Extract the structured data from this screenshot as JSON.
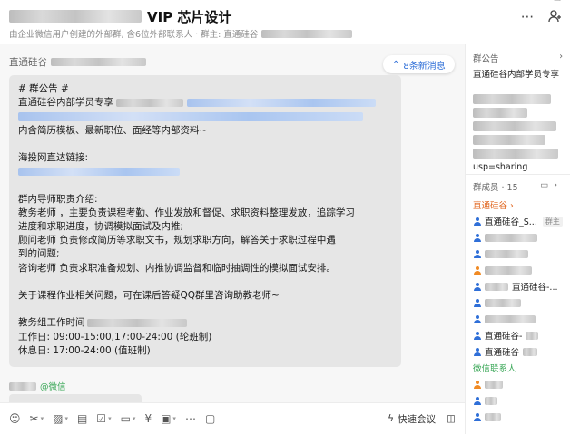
{
  "header": {
    "title": "VIP 芯片设计",
    "subtitle": "由企业微信用户创建的外部群, 含6位外部联系人 · 群主: 直通硅谷"
  },
  "chat": {
    "sender": "直通硅谷",
    "new_messages": "8条新消息",
    "message_lines": [
      "# 群公告 #",
      "直通硅谷内部学员专享",
      "内含简历模板、最新职位、面经等内部资料~",
      "",
      "海投网直达链接:",
      "",
      "",
      "群内导师职责介绍:",
      "教务老师        ，主要负责课程考勤、作业发放和督促、求职资料整理发放，追踪学习",
      "进度和求职进度，协调模拟面试及内推;",
      "顾问老师            负责修改简历等求职文书，规划求职方向，解答关于求职过程中遇",
      "到的问题;",
      "咨询老师          负责求职准备规划、内推协调监督和临时抽调性的模拟面试安排。",
      "",
      "关于课程作业相关问题，可在课后答疑QQ群里咨询助教老师~",
      "",
      "教务组工作时间",
      "工作日: 09:00-15:00,17:00-24:00 (轮班制)",
      "休息日: 17:00-24:00 (值班制)"
    ],
    "next_sender_tag": "@微信"
  },
  "toolbar": {
    "quick_meeting": "快速会议"
  },
  "sidebar": {
    "notice_label": "群公告",
    "notice_text": "直通硅谷内部学员专享",
    "notice_tail": "usp=sharing",
    "members_label": "群成员 · 15",
    "group_zhitong": "直通硅谷 ›",
    "group_wechat": "微信联系人",
    "members": [
      {
        "name": "直通硅谷_S...",
        "tag": "群主",
        "color": "blue"
      },
      {
        "name": "",
        "tag": "",
        "color": "blue"
      },
      {
        "name": "",
        "tag": "",
        "color": "blue"
      },
      {
        "name": "",
        "tag": "",
        "color": "orange"
      },
      {
        "name": "直通硅谷-...",
        "tag": "",
        "color": "blue"
      },
      {
        "name": "",
        "tag": "",
        "color": "blue"
      },
      {
        "name": "",
        "tag": "",
        "color": "blue"
      },
      {
        "name": "直通硅谷-",
        "tag": "",
        "color": "blue"
      },
      {
        "name": "直通硅谷",
        "tag": "",
        "color": "blue"
      }
    ]
  }
}
